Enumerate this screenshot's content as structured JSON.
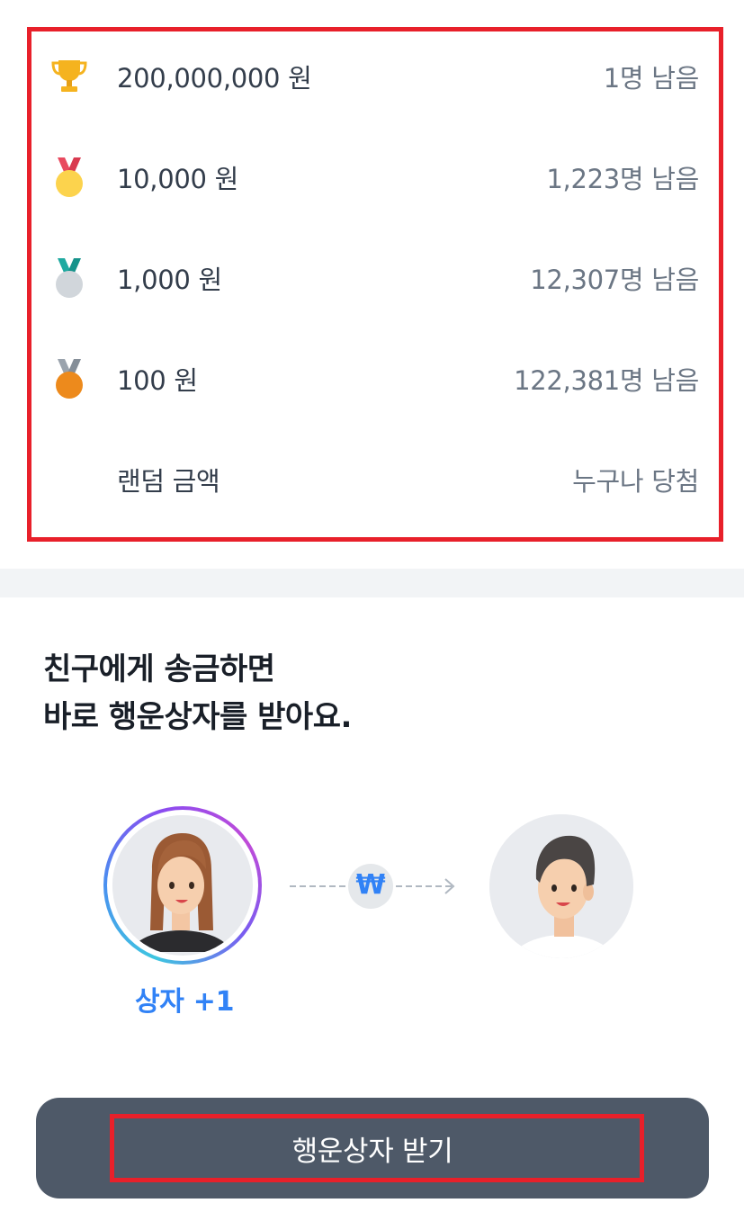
{
  "prizes": [
    {
      "icon": "trophy-icon",
      "amount": "200,000,000 원",
      "remaining": "1명 남음"
    },
    {
      "icon": "gold-medal-icon",
      "amount": "10,000 원",
      "remaining": "1,223명 남음"
    },
    {
      "icon": "silver-medal-icon",
      "amount": "1,000 원",
      "remaining": "12,307명 남음"
    },
    {
      "icon": "bronze-medal-icon",
      "amount": "100 원",
      "remaining": "122,381명 남음"
    },
    {
      "icon": "",
      "amount": "랜덤 금액",
      "remaining": "누구나 당첨"
    }
  ],
  "headline": {
    "line1": "친구에게 송금하면",
    "line2": "바로 행운상자를 받아요."
  },
  "transfer": {
    "currency_symbol": "₩",
    "box_count": "상자 +1"
  },
  "cta": {
    "label": "행운상자 받기"
  },
  "colors": {
    "accent_blue": "#3182f6",
    "highlight_red": "#e8202a",
    "button_bg": "#4e5968"
  }
}
